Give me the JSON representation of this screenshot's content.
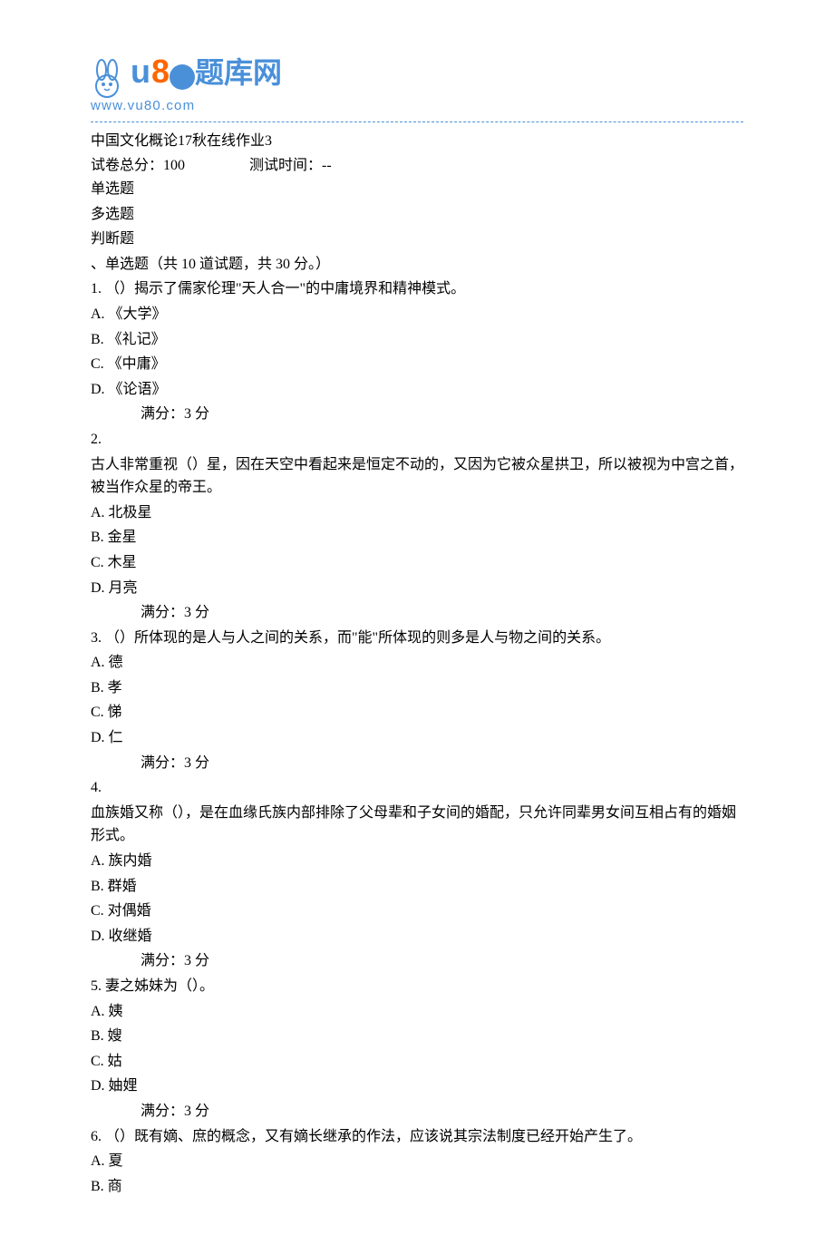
{
  "logo": {
    "prefix": "u",
    "eight": "8",
    "chinese": "题库网",
    "url": "www.vu80.com"
  },
  "header": {
    "title": "中国文化概论17秋在线作业3",
    "total_label": "试卷总分：100",
    "time_label": "测试时间：--",
    "sections": [
      "单选题",
      "多选题",
      "判断题"
    ],
    "section_header": "、单选题（共 10 道试题，共 30 分。）"
  },
  "questions": [
    {
      "num": "1.",
      "text": "  （）揭示了儒家伦理\"天人合一\"的中庸境界和精神模式。",
      "options": [
        "A.  《大学》",
        "B.  《礼记》",
        "C.  《中庸》",
        "D.  《论语》"
      ],
      "score": "满分：3   分"
    },
    {
      "num": "2.",
      "text": "古人非常重视（）星，因在天空中看起来是恒定不动的，又因为它被众星拱卫，所以被视为中宫之首，被当作众星的帝王。",
      "options": [
        "A.  北极星",
        "B.  金星",
        "C.  木星",
        "D.  月亮"
      ],
      "score": "满分：3   分"
    },
    {
      "num": "3.",
      "text": "  （）所体现的是人与人之间的关系，而\"能\"所体现的则多是人与物之间的关系。",
      "options": [
        "A.  德",
        "B.  孝",
        "C.  悌",
        "D.  仁"
      ],
      "score": "满分：3   分"
    },
    {
      "num": "4.",
      "text": "血族婚又称（），是在血缘氏族内部排除了父母辈和子女间的婚配，只允许同辈男女间互相占有的婚姻形式。",
      "options": [
        "A.  族内婚",
        "B.  群婚",
        "C.  对偶婚",
        "D.  收继婚"
      ],
      "score": "满分：3   分"
    },
    {
      "num": "5.",
      "text": "  妻之姊妹为（）。",
      "options": [
        "A.  姨",
        "B.  嫂",
        "C.  姑",
        "D.  妯娌"
      ],
      "score": "满分：3   分"
    },
    {
      "num": "6.",
      "text": "  （）既有嫡、庶的概念，又有嫡长继承的作法，应该说其宗法制度已经开始产生了。",
      "options": [
        "A.  夏",
        "B.  商"
      ],
      "score": null
    }
  ]
}
